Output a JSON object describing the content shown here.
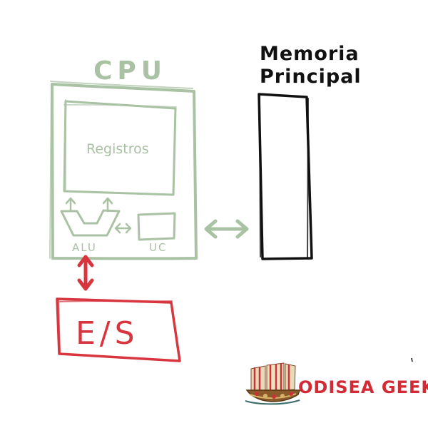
{
  "colors": {
    "cpu": "#a9c2a3",
    "memory": "#111111",
    "io": "#d8363f",
    "logo_text": "#d32b36"
  },
  "cpu": {
    "title": "CPU",
    "registers_label": "Registros",
    "alu_label": "ALU",
    "uc_label": "UC"
  },
  "memory": {
    "title_line1": "Memoria",
    "title_line2": "Principal"
  },
  "io": {
    "label": "E/S"
  },
  "logo": {
    "text": "ODISEA GEEK",
    "icon": "viking-ship-icon"
  }
}
